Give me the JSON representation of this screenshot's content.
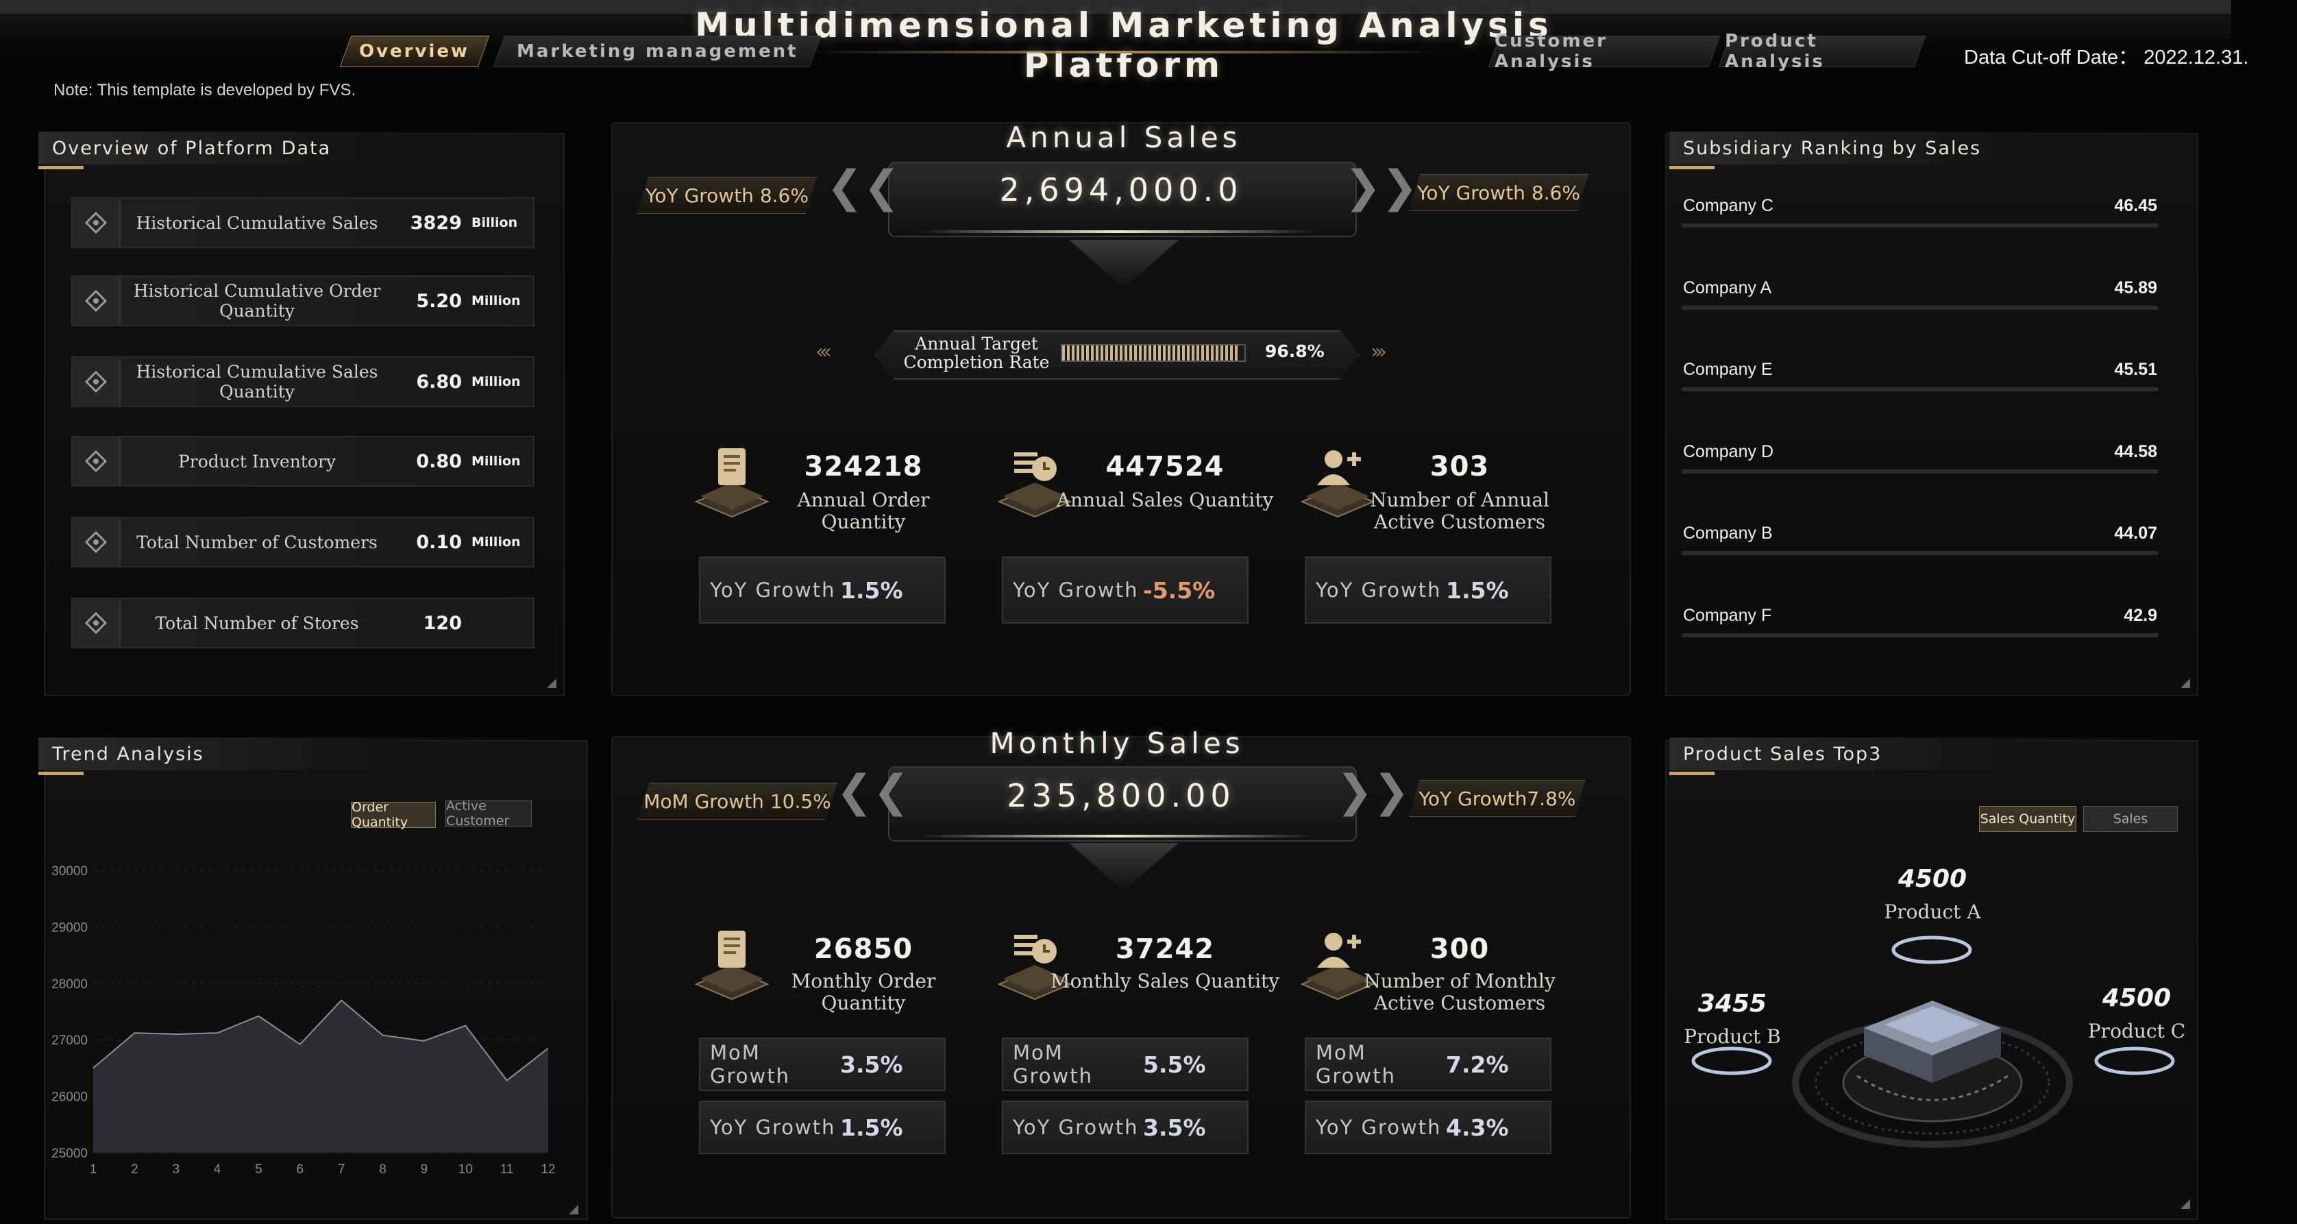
{
  "header": {
    "title": "Multidimensional Marketing Analysis Platform",
    "tabs_left": [
      "Overview",
      "Marketing management"
    ],
    "tabs_right": [
      "Customer Analysis",
      "Product Analysis"
    ],
    "cutoff": "Data Cut-off Date： 2022.12.31.",
    "note": "Note: This template is developed by FVS."
  },
  "overview": {
    "title": "Overview of Platform Data",
    "items": [
      {
        "label": "Historical Cumulative Sales",
        "value": "3829",
        "unit": "Billion"
      },
      {
        "label": "Historical Cumulative Order Quantity",
        "value": "5.20",
        "unit": "Million"
      },
      {
        "label": "Historical Cumulative Sales Quantity",
        "value": "6.80",
        "unit": "Million"
      },
      {
        "label": "Product Inventory",
        "value": "0.80",
        "unit": "Million"
      },
      {
        "label": "Total Number of Customers",
        "value": "0.10",
        "unit": "Million"
      },
      {
        "label": "Total Number of Stores",
        "value": "120",
        "unit": ""
      }
    ]
  },
  "annual": {
    "title": "Annual Sales",
    "value": "2,694,000.0",
    "growth_left": "YoY Growth 8.6%",
    "growth_right": "YoY Growth 8.6%",
    "target_label_1": "Annual Target",
    "target_label_2": "Completion Rate",
    "target_pct": "96.8%",
    "target_fraction": 0.968,
    "stats": [
      {
        "value": "324218",
        "label": "Annual Order Quantity",
        "label2": "",
        "g_label": "YoY Growth",
        "g_value": "1.5%"
      },
      {
        "value": "447524",
        "label": "Annual Sales Quantity",
        "label2": "",
        "g_label": "YoY Growth",
        "g_value": "-5.5%"
      },
      {
        "value": "303",
        "label": "Number of Annual",
        "label2": "Active Customers",
        "g_label": "YoY Growth",
        "g_value": "1.5%"
      }
    ]
  },
  "monthly": {
    "title": "Monthly Sales",
    "value": "235,800.00",
    "growth_left": "MoM Growth 10.5%",
    "growth_right": "YoY Growth7.8%",
    "stats": [
      {
        "value": "26850",
        "label": "Monthly Order Quantity",
        "label2": "",
        "mom_label": "MoM Growth",
        "mom": "3.5%",
        "yoy_label": "YoY Growth",
        "yoy": "1.5%"
      },
      {
        "value": "37242",
        "label": "Monthly Sales Quantity",
        "label2": "",
        "mom_label": "MoM Growth",
        "mom": "5.5%",
        "yoy_label": "YoY Growth",
        "yoy": "3.5%"
      },
      {
        "value": "300",
        "label": "Number of Monthly",
        "label2": "Active Customers",
        "mom_label": "MoM Growth",
        "mom": "7.2%",
        "yoy_label": "YoY Growth",
        "yoy": "4.3%"
      }
    ]
  },
  "ranking": {
    "title": "Subsidiary Ranking by Sales",
    "rows": [
      {
        "name": "Company C",
        "value": "46.45"
      },
      {
        "name": "Company A",
        "value": "45.89"
      },
      {
        "name": "Company E",
        "value": "45.51"
      },
      {
        "name": "Company D",
        "value": "44.58"
      },
      {
        "name": "Company B",
        "value": "44.07"
      },
      {
        "name": "Company F",
        "value": "42.9"
      }
    ]
  },
  "trend": {
    "title": "Trend Analysis",
    "toggle_1": "Order Quantity",
    "toggle_2": "Active Customer"
  },
  "chart_data": {
    "type": "area",
    "x": [
      1,
      2,
      3,
      4,
      5,
      6,
      7,
      8,
      9,
      10,
      11,
      12
    ],
    "series": [
      {
        "values": [
          26500,
          27120,
          27100,
          27120,
          27420,
          26920,
          27700,
          27080,
          26980,
          27250,
          26280,
          26850
        ]
      }
    ],
    "ylim": [
      25000,
      30000
    ],
    "yticks": [
      25000,
      26000,
      27000,
      28000,
      29000,
      30000
    ],
    "grid": true,
    "colors": {
      "fill": "#2e3035",
      "line": "#8c8f97"
    }
  },
  "product": {
    "title": "Product Sales Top3",
    "toggle_1": "Sales Quantity",
    "toggle_2": "Sales",
    "items": [
      {
        "value": "4500",
        "name": "Product A"
      },
      {
        "value": "3455",
        "name": "Product B"
      },
      {
        "value": "4500",
        "name": "Product C"
      }
    ]
  },
  "colors": {
    "accent": "#c9a76c",
    "negative": "#e59a6d",
    "panel": "#101010"
  }
}
